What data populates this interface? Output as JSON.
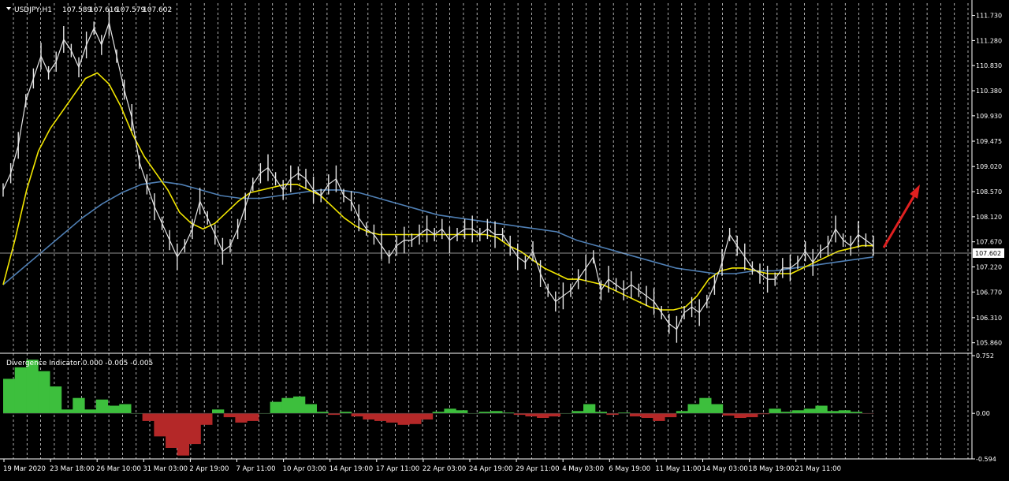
{
  "main_panel": {
    "header": {
      "symbol_tf": "USDJPY,H1",
      "open": "107.589",
      "high": "107.616",
      "low": "107.579",
      "close": "107.602"
    },
    "price_axis_ticks": [
      "111.730",
      "111.280",
      "110.830",
      "110.380",
      "109.930",
      "109.475",
      "109.020",
      "108.570",
      "108.120",
      "107.670",
      "107.220",
      "106.770",
      "106.310",
      "105.860"
    ],
    "current_price_label": "107.602"
  },
  "indicator_panel": {
    "title": "Divergence Indicator 0.000 -0.005 -0.005",
    "axis_ticks": [
      "0.752",
      "0.00",
      "-0.594"
    ]
  },
  "time_axis_labels": [
    "19 Mar 2020",
    "23 Mar 18:00",
    "26 Mar 10:00",
    "31 Mar 03:00",
    "2 Apr 19:00",
    "7 Apr 11:00",
    "10 Apr 03:00",
    "14 Apr 19:00",
    "17 Apr 11:00",
    "22 Apr 03:00",
    "24 Apr 19:00",
    "29 Apr 11:00",
    "4 May 03:00",
    "6 May 19:00",
    "11 May 11:00",
    "14 May 03:00",
    "18 May 19:00",
    "21 May 11:00"
  ],
  "colors": {
    "background": "#000000",
    "price": "#e6e6e6",
    "ma_fast": "#f2e600",
    "ma_slow": "#4f7fb4",
    "osc_positive": "#3dbf3d",
    "osc_negative": "#b42828",
    "grid": "#d8d8d8",
    "arrow": "#e02020"
  },
  "chart_data": [
    {
      "type": "line",
      "title": "USDJPY,H1",
      "x_labels": [
        "19 Mar 2020",
        "23 Mar 18:00",
        "26 Mar 10:00",
        "31 Mar 03:00",
        "2 Apr 19:00",
        "7 Apr 11:00",
        "10 Apr 03:00",
        "14 Apr 19:00",
        "17 Apr 11:00",
        "22 Apr 03:00",
        "24 Apr 19:00",
        "29 Apr 11:00",
        "4 May 03:00",
        "6 May 19:00",
        "11 May 11:00",
        "14 May 03:00",
        "18 May 19:00",
        "21 May 11:00"
      ],
      "ylim": [
        105.7,
        111.95
      ],
      "series": [
        {
          "values": [
            108.6,
            108.9,
            109.4,
            110.2,
            110.6,
            111.0,
            110.7,
            110.9,
            111.3,
            111.1,
            110.8,
            111.2,
            111.5,
            111.2,
            111.6,
            111.0,
            110.4,
            109.9,
            109.1,
            108.7,
            108.3,
            108.0,
            107.7,
            107.4,
            107.6,
            107.9,
            108.4,
            108.1,
            107.8,
            107.5,
            107.6,
            107.9,
            108.3,
            108.7,
            108.9,
            109.0,
            108.8,
            108.6,
            108.8,
            108.9,
            108.8,
            108.6,
            108.5,
            108.7,
            108.8,
            108.5,
            108.4,
            108.1,
            107.9,
            107.8,
            107.6,
            107.4,
            107.6,
            107.7,
            107.7,
            107.8,
            107.9,
            107.8,
            107.9,
            107.7,
            107.8,
            107.9,
            107.9,
            107.8,
            107.9,
            107.8,
            107.8,
            107.6,
            107.4,
            107.3,
            107.5,
            107.1,
            106.8,
            106.6,
            106.7,
            106.8,
            107.0,
            107.2,
            107.4,
            106.8,
            107.0,
            106.9,
            106.8,
            106.9,
            106.8,
            106.7,
            106.6,
            106.4,
            106.2,
            106.1,
            106.4,
            106.5,
            106.4,
            106.6,
            106.9,
            107.3,
            107.8,
            107.6,
            107.4,
            107.2,
            107.1,
            107.0,
            107.0,
            107.2,
            107.2,
            107.3,
            107.5,
            107.3,
            107.5,
            107.6,
            107.9,
            107.7,
            107.6,
            107.8,
            107.7,
            107.6
          ]
        },
        {
          "values": [
            106.9,
            107.7,
            108.6,
            109.3,
            109.7,
            110.0,
            110.3,
            110.6,
            110.7,
            110.5,
            110.1,
            109.6,
            109.2,
            108.9,
            108.6,
            108.2,
            108.0,
            107.9,
            108.0,
            108.2,
            108.4,
            108.55,
            108.6,
            108.65,
            108.7,
            108.7,
            108.6,
            108.5,
            108.3,
            108.1,
            107.95,
            107.85,
            107.8,
            107.8,
            107.8,
            107.8,
            107.8,
            107.8,
            107.8,
            107.8,
            107.8,
            107.8,
            107.75,
            107.6,
            107.5,
            107.35,
            107.2,
            107.1,
            107.0,
            107.0,
            106.95,
            106.9,
            106.8,
            106.7,
            106.6,
            106.5,
            106.45,
            106.45,
            106.5,
            106.7,
            107.0,
            107.15,
            107.2,
            107.2,
            107.15,
            107.1,
            107.1,
            107.1,
            107.2,
            107.3,
            107.4,
            107.5,
            107.55,
            107.6,
            107.6
          ]
        },
        {
          "values": [
            106.9,
            107.2,
            107.5,
            107.8,
            108.1,
            108.35,
            108.55,
            108.7,
            108.75,
            108.7,
            108.6,
            108.5,
            108.45,
            108.45,
            108.5,
            108.55,
            108.6,
            108.6,
            108.55,
            108.45,
            108.35,
            108.25,
            108.15,
            108.1,
            108.05,
            108.0,
            107.95,
            107.9,
            107.85,
            107.7,
            107.6,
            107.5,
            107.4,
            107.3,
            107.2,
            107.15,
            107.1,
            107.1,
            107.15,
            107.15,
            107.2,
            107.25,
            107.3,
            107.35,
            107.4
          ]
        }
      ]
    },
    {
      "type": "area",
      "title": "Divergence Indicator 0.000 -0.005 -0.005",
      "ylim": [
        -0.594,
        0.752
      ],
      "values": [
        0.45,
        0.6,
        0.7,
        0.55,
        0.35,
        0.05,
        0.2,
        0.05,
        0.18,
        0.1,
        0.12,
        0.0,
        -0.1,
        -0.3,
        -0.45,
        -0.55,
        -0.4,
        -0.15,
        0.05,
        -0.05,
        -0.12,
        -0.1,
        0.0,
        0.15,
        0.2,
        0.22,
        0.12,
        0.02,
        -0.02,
        0.02,
        -0.04,
        -0.08,
        -0.1,
        -0.12,
        -0.15,
        -0.14,
        -0.08,
        0.02,
        0.06,
        0.04,
        0.0,
        0.02,
        0.03,
        0.01,
        -0.02,
        -0.04,
        -0.06,
        -0.04,
        0.0,
        0.03,
        0.12,
        0.02,
        -0.02,
        0.01,
        -0.04,
        -0.06,
        -0.1,
        -0.05,
        0.03,
        0.12,
        0.2,
        0.12,
        -0.03,
        -0.06,
        -0.05,
        -0.01,
        0.06,
        0.02,
        0.04,
        0.06,
        0.1,
        0.03,
        0.04,
        0.02,
        -0.005
      ]
    }
  ]
}
